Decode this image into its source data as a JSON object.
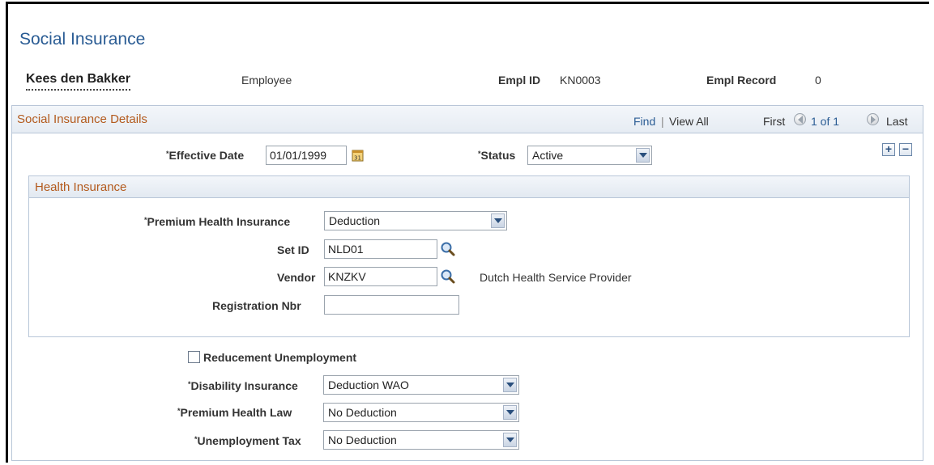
{
  "page": {
    "title": "Social Insurance"
  },
  "employee": {
    "name": "Kees den Bakker",
    "type": "Employee",
    "emplid_label": "Empl ID",
    "emplid": "KN0003",
    "emplrecord_label": "Empl Record",
    "emplrecord": "0"
  },
  "details": {
    "title": "Social Insurance Details",
    "nav": {
      "find": "Find",
      "separator": "|",
      "view_all": "View All",
      "first": "First",
      "count": "1 of 1",
      "last": "Last"
    },
    "effective_date": {
      "label": "Effective Date",
      "value": "01/01/1999"
    },
    "status": {
      "label": "Status",
      "value": "Active"
    },
    "add_row": "+",
    "delete_row": "−"
  },
  "health": {
    "title": "Health Insurance",
    "premium_health_insurance": {
      "label": "Premium Health Insurance",
      "value": "Deduction"
    },
    "set_id": {
      "label": "Set ID",
      "value": "NLD01"
    },
    "vendor": {
      "label": "Vendor",
      "value": "KNZKV",
      "description": "Dutch Health Service Provider"
    },
    "registration_nbr": {
      "label": "Registration Nbr",
      "value": ""
    }
  },
  "other": {
    "reducement_unemployment": {
      "label": "Reducement Unemployment",
      "checked": false
    },
    "disability_insurance": {
      "label": "Disability Insurance",
      "value": "Deduction WAO"
    },
    "premium_health_law": {
      "label": "Premium Health Law",
      "value": "No Deduction"
    },
    "unemployment_tax": {
      "label": "Unemployment Tax",
      "value": "No Deduction"
    }
  },
  "colors": {
    "title_blue": "#2a5c94",
    "section_orange": "#b35a1d",
    "border": "#b8c6d8"
  },
  "icons": {
    "calendar": "calendar-icon",
    "lookup": "magnifier-icon",
    "dropdown": "chevron-down-icon",
    "prev": "previous-arrow-icon",
    "next": "next-arrow-icon"
  }
}
